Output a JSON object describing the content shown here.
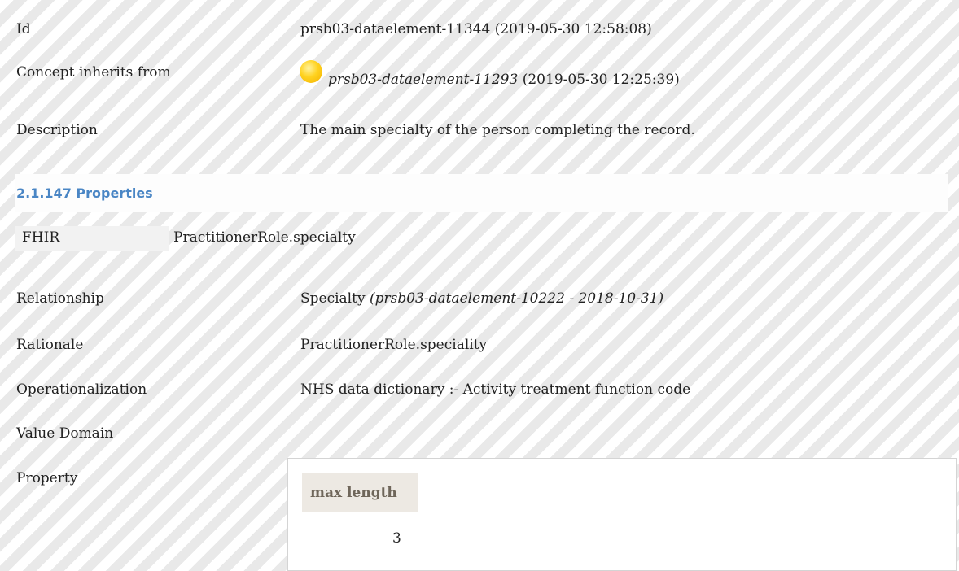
{
  "rows": {
    "id": {
      "label": "Id",
      "value": "prsb03-dataelement-11344 (2019-05-30 12:58:08)"
    },
    "inherits": {
      "label": "Concept inherits from",
      "link": "prsb03-dataelement-11293",
      "date": "(2019-05-30 12:25:39)"
    },
    "description": {
      "label": "Description",
      "value": "The main specialty of the person completing the record."
    }
  },
  "section": {
    "title": "2.1.147 Properties"
  },
  "fhir": {
    "label": "FHIR",
    "value": "PractitionerRole.specialty"
  },
  "relationship": {
    "label": "Relationship",
    "value": "Specialty",
    "ref": "(prsb03-dataelement-10222 - 2018-10-31)"
  },
  "rationale": {
    "label": "Rationale",
    "value": "PractitionerRole.speciality"
  },
  "operationalization": {
    "label": "Operationalization",
    "value": "NHS data dictionary :- Activity treatment function code"
  },
  "value_domain": {
    "label": "Value Domain"
  },
  "property": {
    "label": "Property",
    "column_header": "max length",
    "value": "3"
  },
  "colors": {
    "section_title": "#4a86c5",
    "badge": "#ffd21f",
    "header_cell": "#ede9e3"
  }
}
